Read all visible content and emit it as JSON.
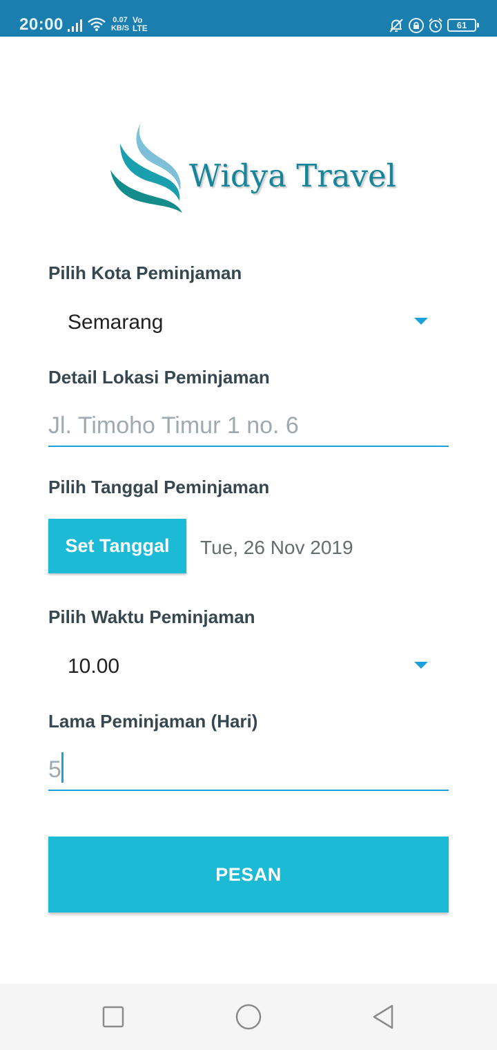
{
  "status_bar": {
    "time": "20:00",
    "speed_value": "0.07",
    "speed_unit": "KB/S",
    "network_vo": "Vo",
    "network_lte": "LTE",
    "battery": "61",
    "icons": [
      "signal-icon",
      "wifi-icon",
      "bell-off-icon",
      "lock-rotation-icon",
      "alarm-icon",
      "battery-icon"
    ]
  },
  "logo": {
    "text": "Widya Travel",
    "colors": {
      "light": "#7dc0d8",
      "mid": "#1a9fae",
      "dark": "#138c8c"
    }
  },
  "form": {
    "city_label": "Pilih Kota Peminjaman",
    "city_value": "Semarang",
    "location_label": "Detail Lokasi Peminjaman",
    "location_value": "Jl. Timoho Timur 1 no. 6",
    "date_label": "Pilih Tanggal Peminjaman",
    "date_button": "Set Tanggal",
    "date_value": "Tue, 26 Nov 2019",
    "time_label": "Pilih Waktu Peminjaman",
    "time_value": "10.00",
    "duration_label": "Lama Peminjaman (Hari)",
    "duration_value": "5",
    "submit_button": "PESAN"
  },
  "colors": {
    "status_bar": "#1a7fae",
    "accent": "#1dbad6",
    "underline": "#1ba0dc"
  },
  "nav_bar": {
    "icons": [
      "square-icon",
      "circle-icon",
      "triangle-back-icon"
    ]
  }
}
